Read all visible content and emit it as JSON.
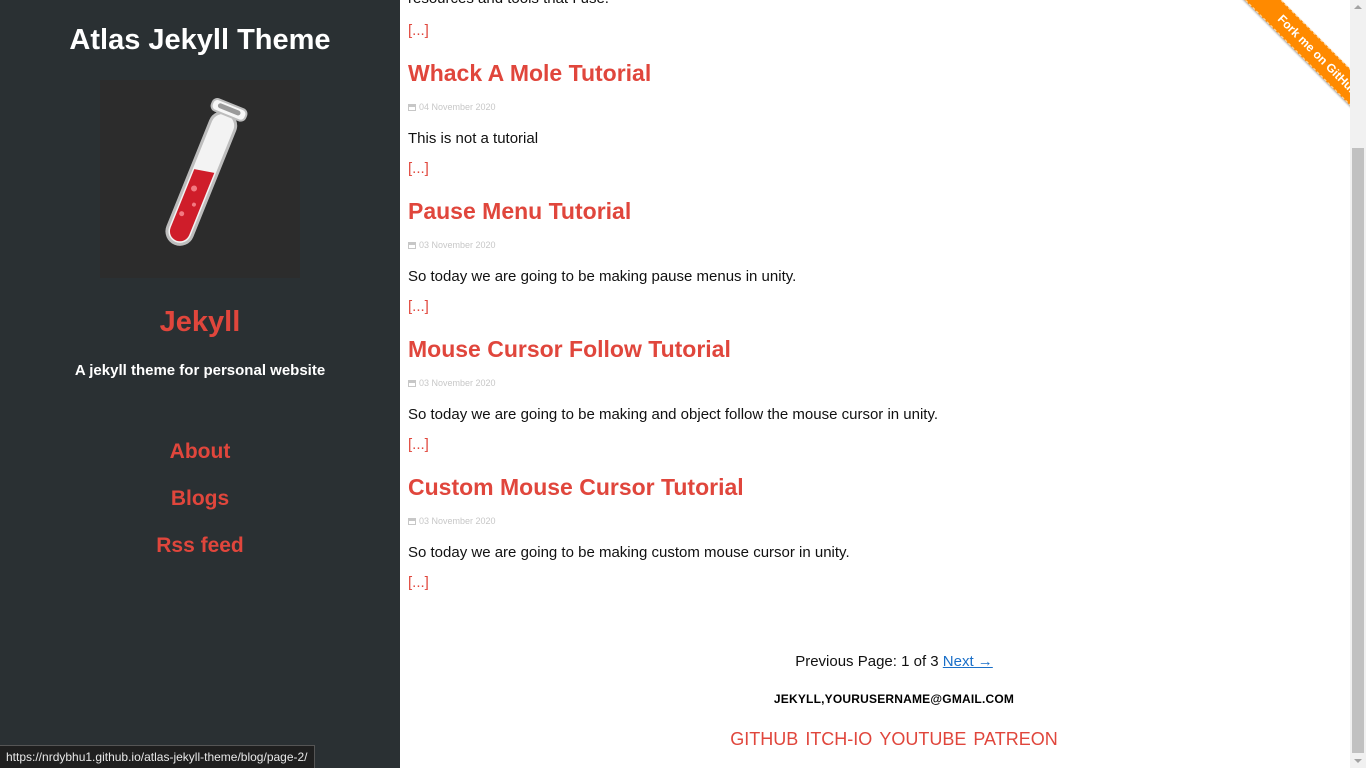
{
  "sidebar": {
    "site_title": "Atlas Jekyll Theme",
    "avatar_icon": "test-tube-icon",
    "profile_name": "Jekyll",
    "tagline": "A jekyll theme for personal website",
    "nav": [
      {
        "label": "About"
      },
      {
        "label": "Blogs"
      },
      {
        "label": "Rss feed"
      }
    ]
  },
  "main": {
    "intro_text": "resources and tools that I use.",
    "read_more": "[...]",
    "posts": [
      {
        "title": "Whack A Mole Tutorial",
        "date": "04 November 2020",
        "excerpt": "This is not a tutorial",
        "more": "[...]"
      },
      {
        "title": "Pause Menu Tutorial",
        "date": "03 November 2020",
        "excerpt": "So today we are going to be making pause menus in unity.",
        "more": "[...]"
      },
      {
        "title": "Mouse Cursor Follow Tutorial",
        "date": "03 November 2020",
        "excerpt": "So today we are going to be making and object follow the mouse cursor in unity.",
        "more": "[...]"
      },
      {
        "title": "Custom Mouse Cursor Tutorial",
        "date": "03 November 2020",
        "excerpt": "So today we are going to be making custom mouse cursor in unity.",
        "more": "[...]"
      }
    ],
    "pagination": {
      "previous": "Previous",
      "page_info": "Page: 1 of 3",
      "next": "Next →"
    }
  },
  "footer": {
    "contact": "JEKYLL,YOURUSERNAME@GMAIL.COM",
    "social": [
      "GITHUB",
      "ITCH-IO",
      "YOUTUBE",
      "PATREON"
    ]
  },
  "ribbon": {
    "label": "Fork me on GitHub",
    "color": "#ff8a00"
  },
  "status_url": "https://nrdybhu1.github.io/atlas-jekyll-theme/blog/page-2/",
  "colors": {
    "accent": "#e0463c",
    "sidebar_bg": "#2a3033",
    "link": "#1a6fc8"
  }
}
